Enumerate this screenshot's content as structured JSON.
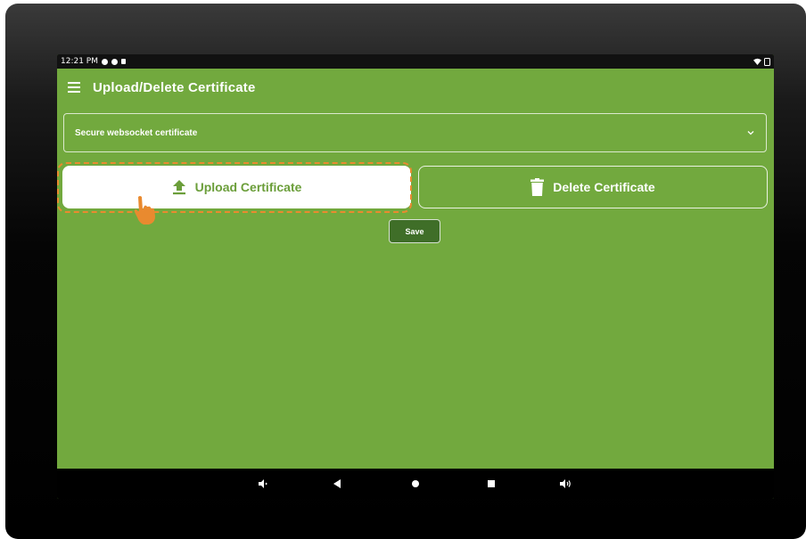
{
  "status_bar": {
    "time": "12:21 PM",
    "icons": [
      "notification-icon",
      "notification-icon",
      "sd-card-icon",
      "wifi-icon",
      "no-sim-icon"
    ]
  },
  "app_bar": {
    "title": "Upload/Delete Certificate",
    "menu_icon": "hamburger-menu-icon"
  },
  "certificate_select": {
    "selected": "Secure websocket certificate"
  },
  "actions": {
    "upload_label": "Upload Certificate",
    "delete_label": "Delete Certificate",
    "save_label": "Save"
  },
  "nav_bar": {
    "icons": [
      "volume-down-icon",
      "back-icon",
      "home-icon",
      "recents-icon",
      "volume-up-icon"
    ]
  },
  "colors": {
    "screen_bg": "#72a93e",
    "highlight": "#e98a2f",
    "save_bg": "#3f6e28",
    "upload_text": "#6b9e3a"
  }
}
